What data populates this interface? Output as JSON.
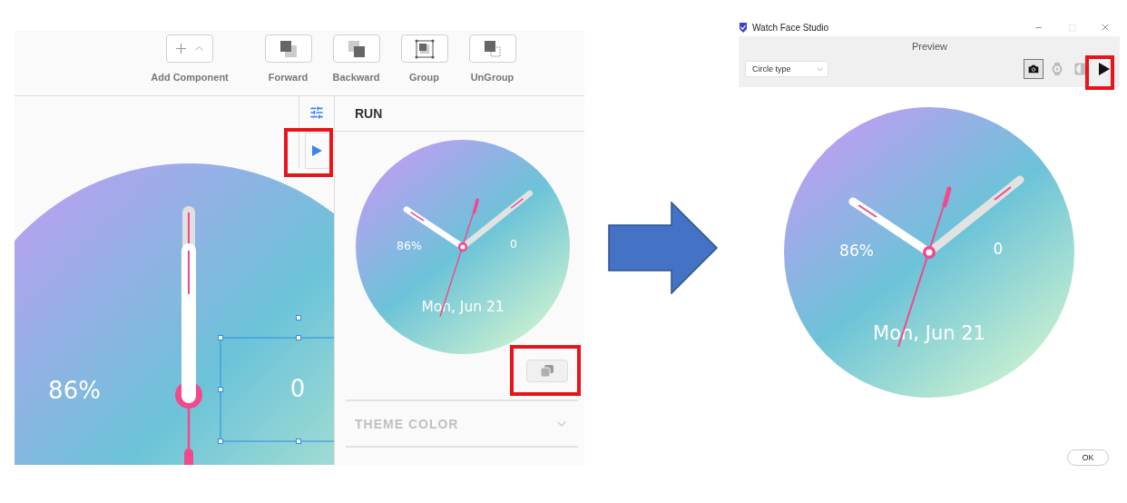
{
  "editor": {
    "toolbar": [
      {
        "kind": "add",
        "label": "Add Component"
      },
      {
        "kind": "forward",
        "label": "Forward"
      },
      {
        "kind": "backward",
        "label": "Backward"
      },
      {
        "kind": "group",
        "label": "Group"
      },
      {
        "kind": "ungroup",
        "label": "UnGroup"
      }
    ],
    "canvas": {
      "battery": "86%",
      "steps": "0"
    },
    "run_panel": {
      "title": "RUN",
      "watch": {
        "battery": "86%",
        "steps": "0",
        "date": "Mon, Jun 21"
      },
      "sections": [
        {
          "title": "THEME COLOR",
          "expanded": false
        }
      ]
    }
  },
  "preview_window": {
    "title": "Watch Face Studio",
    "header": "Preview",
    "shape_select": {
      "value": "Circle type"
    },
    "tools": [
      {
        "kind": "screenshot",
        "selected": true,
        "disabled": false
      },
      {
        "kind": "watch",
        "selected": false,
        "disabled": true
      },
      {
        "kind": "ambient",
        "selected": false,
        "disabled": true
      },
      {
        "kind": "play",
        "selected": false,
        "disabled": false
      }
    ],
    "watch": {
      "battery": "86%",
      "steps": "0",
      "date": "Mon, Jun 21"
    },
    "buttons": [
      "OK"
    ]
  }
}
